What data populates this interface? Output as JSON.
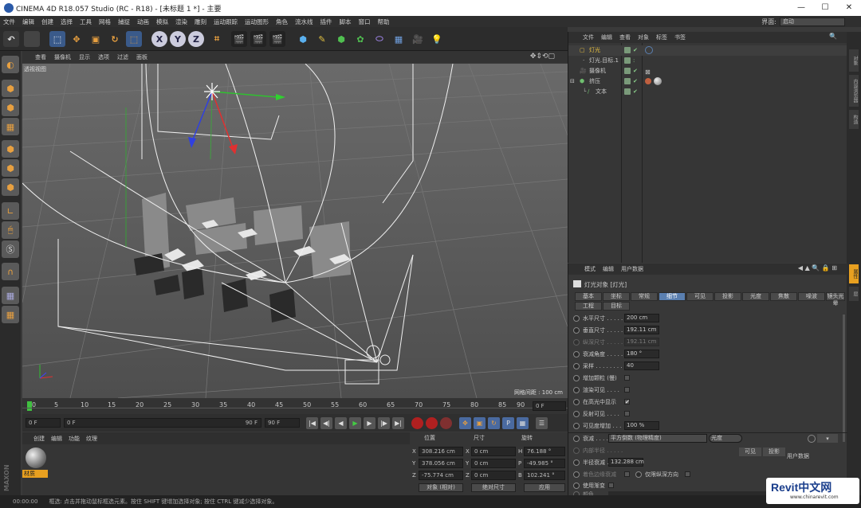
{
  "window": {
    "title": "CINEMA 4D R18.057 Studio (RC - R18) - [未标题 1 *] - 主要",
    "min": "—",
    "max": "☐",
    "close": "✕"
  },
  "menubar": [
    "文件",
    "编辑",
    "创建",
    "选择",
    "工具",
    "网格",
    "捕捉",
    "动画",
    "模拟",
    "渲染",
    "雕刻",
    "运动跟踪",
    "运动图形",
    "角色",
    "流水线",
    "插件",
    "脚本",
    "窗口",
    "帮助"
  ],
  "layout": {
    "label": "界面:",
    "value": "启动"
  },
  "toolbar": {
    "x": "X",
    "y": "Y",
    "z": "Z"
  },
  "viewport": {
    "menu": [
      "查看",
      "摄像机",
      "显示",
      "选项",
      "过滤",
      "面板"
    ],
    "label": "透视视图",
    "grid_info": "网格间距 : 100 cm",
    "text3d": "KEEP"
  },
  "timeline": {
    "ticks": [
      "0",
      "5",
      "10",
      "15",
      "20",
      "25",
      "30",
      "35",
      "40",
      "45",
      "50",
      "55",
      "60",
      "65",
      "70",
      "75",
      "80",
      "85",
      "90"
    ],
    "end_field": "0 F"
  },
  "playbar": {
    "start": "0 F",
    "range_start": "0 F",
    "range_end": "90 F",
    "end": "90 F"
  },
  "materials": {
    "menu": [
      "创建",
      "编辑",
      "功能",
      "纹理"
    ],
    "item": "材质"
  },
  "coords": {
    "headers": [
      "位置",
      "尺寸",
      "旋转"
    ],
    "rows": [
      {
        "axis": "X",
        "pos": "308.216 cm",
        "size_axis": "X",
        "size": "0 cm",
        "rot_axis": "H",
        "rot": "76.188 °"
      },
      {
        "axis": "Y",
        "pos": "378.056 cm",
        "size_axis": "Y",
        "size": "0 cm",
        "rot_axis": "P",
        "rot": "-49.985 °"
      },
      {
        "axis": "Z",
        "pos": "-75.774 cm",
        "size_axis": "Z",
        "size": "0 cm",
        "rot_axis": "B",
        "rot": "102.241 °"
      }
    ],
    "mode": "对象 (相对)",
    "size_mode": "绝对尺寸",
    "apply": "应用"
  },
  "objects": {
    "menu": [
      "文件",
      "编辑",
      "查看",
      "对象",
      "标签",
      "书签"
    ],
    "items": [
      {
        "name": "灯光",
        "color": "#e8c040"
      },
      {
        "name": "灯光.目标.1",
        "color": "#c8c8c8"
      },
      {
        "name": "摄像机",
        "color": "#c8c8c8"
      },
      {
        "name": "挤压",
        "color": "#c8c8c8"
      },
      {
        "name": "文本",
        "color": "#c8c8c8"
      }
    ]
  },
  "attributes": {
    "menu": [
      "模式",
      "编辑",
      "用户数据"
    ],
    "title": "灯光对象 [灯光]",
    "tabs": [
      "基本",
      "坐标",
      "常规",
      "细节",
      "可见",
      "投影",
      "光度",
      "焦散",
      "噪波",
      "镜头光晕",
      "工程",
      "目标"
    ],
    "props": [
      {
        "label": "水平尺寸 . . . . .",
        "value": "200 cm"
      },
      {
        "label": "垂直尺寸 . . . . .",
        "value": "192.11 cm"
      },
      {
        "label": "纵深尺寸 . . . . .",
        "value": "192.11 cm"
      },
      {
        "label": "衰减角度 . . . . .",
        "value": "180 °"
      },
      {
        "label": "采样 . . . . . . . .",
        "value": "40"
      },
      {
        "label": "增加颗粒 (慢)",
        "value": ""
      },
      {
        "label": "渲染可见 . . . .",
        "value": ""
      },
      {
        "label": "在高光中显示",
        "value": "✔"
      },
      {
        "label": "反射可见 . . . .",
        "value": ""
      },
      {
        "label": "可见度增加 . . .",
        "value": "100 %"
      }
    ],
    "falloff": {
      "label": "衰减 . . . . . . . .",
      "value": "平方倒数 (物理精度)",
      "extra": "光度"
    },
    "inner_radius": "内部半径 . . . . .",
    "radius": {
      "label": "半径衰减 . . . . .",
      "value": "132.288 cm"
    },
    "colorize": "着色边缘衰减",
    "only_z": "仅限纵深方向",
    "use_gradient": "使用渐变",
    "color_label": "颜色",
    "popup": {
      "visible": "可见",
      "shadow": "投影",
      "user": "用户数据"
    }
  },
  "right_tabs": [
    "对象",
    "内容浏览器",
    "构造",
    "属性",
    "层"
  ],
  "status": {
    "time": "00:00:00",
    "text": "框选: 点击并拖动鼠标框选元素。按住 SHIFT 键增加选择对象; 按住 CTRL 键减少选择对象。"
  },
  "watermark": {
    "brand": "Revit中文网",
    "url": "www.chinarevit.com"
  },
  "colors": {
    "accent": "#5a7fb0",
    "selected_object": "#e8c040",
    "material_label": "#e8a020"
  }
}
